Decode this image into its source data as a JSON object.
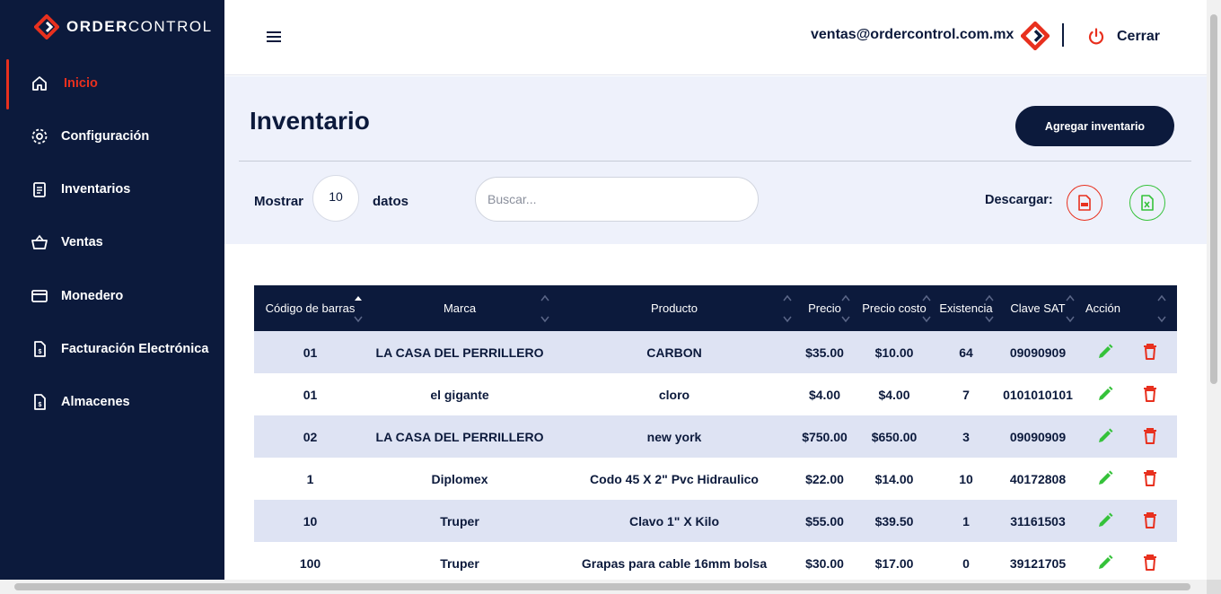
{
  "brand": {
    "name_bold": "ORDER",
    "name_light": "CONTROL",
    "accent": "#e8301e",
    "navy": "#0c1a3c"
  },
  "sidebar": {
    "items": [
      {
        "label": "Inicio",
        "icon": "home-icon",
        "active": true
      },
      {
        "label": "Configuración",
        "icon": "gear-icon"
      },
      {
        "label": "Inventarios",
        "icon": "clipboard-icon"
      },
      {
        "label": "Ventas",
        "icon": "basket-icon"
      },
      {
        "label": "Monedero",
        "icon": "card-icon"
      },
      {
        "label": "Facturación Electrónica",
        "icon": "invoice-icon"
      },
      {
        "label": "Almacenes",
        "icon": "invoice-icon"
      }
    ]
  },
  "header": {
    "user_email": "ventas@ordercontrol.com.mx",
    "logout_label": "Cerrar"
  },
  "page": {
    "title": "Inventario",
    "add_button": "Agregar inventario",
    "show_label": "Mostrar",
    "show_value": "10",
    "show_suffix": "datos",
    "search_placeholder": "Buscar...",
    "download_label": "Descargar:"
  },
  "table": {
    "columns": [
      "Código de barras",
      "Marca",
      "Producto",
      "Precio",
      "Precio costo",
      "Existencia",
      "Clave SAT",
      "Acción"
    ],
    "sorted_column": "Código de barras",
    "sort_direction": "ascending",
    "rows": [
      [
        "01",
        "LA CASA DEL PERRILLERO",
        "CARBON",
        "$35.00",
        "$10.00",
        "64",
        "09090909"
      ],
      [
        "01",
        "el gigante",
        "cloro",
        "$4.00",
        "$4.00",
        "7",
        "0101010101"
      ],
      [
        "02",
        "LA CASA DEL PERRILLERO",
        "new york",
        "$750.00",
        "$650.00",
        "3",
        "09090909"
      ],
      [
        "1",
        "Diplomex",
        "Codo 45 X 2\" Pvc Hidraulico",
        "$22.00",
        "$14.00",
        "10",
        "40172808"
      ],
      [
        "10",
        "Truper",
        "Clavo 1\" X Kilo",
        "$55.00",
        "$39.50",
        "1",
        "31161503"
      ],
      [
        "100",
        "Truper",
        "Grapas para cable 16mm bolsa",
        "$30.00",
        "$17.00",
        "0",
        "39121705"
      ]
    ]
  }
}
